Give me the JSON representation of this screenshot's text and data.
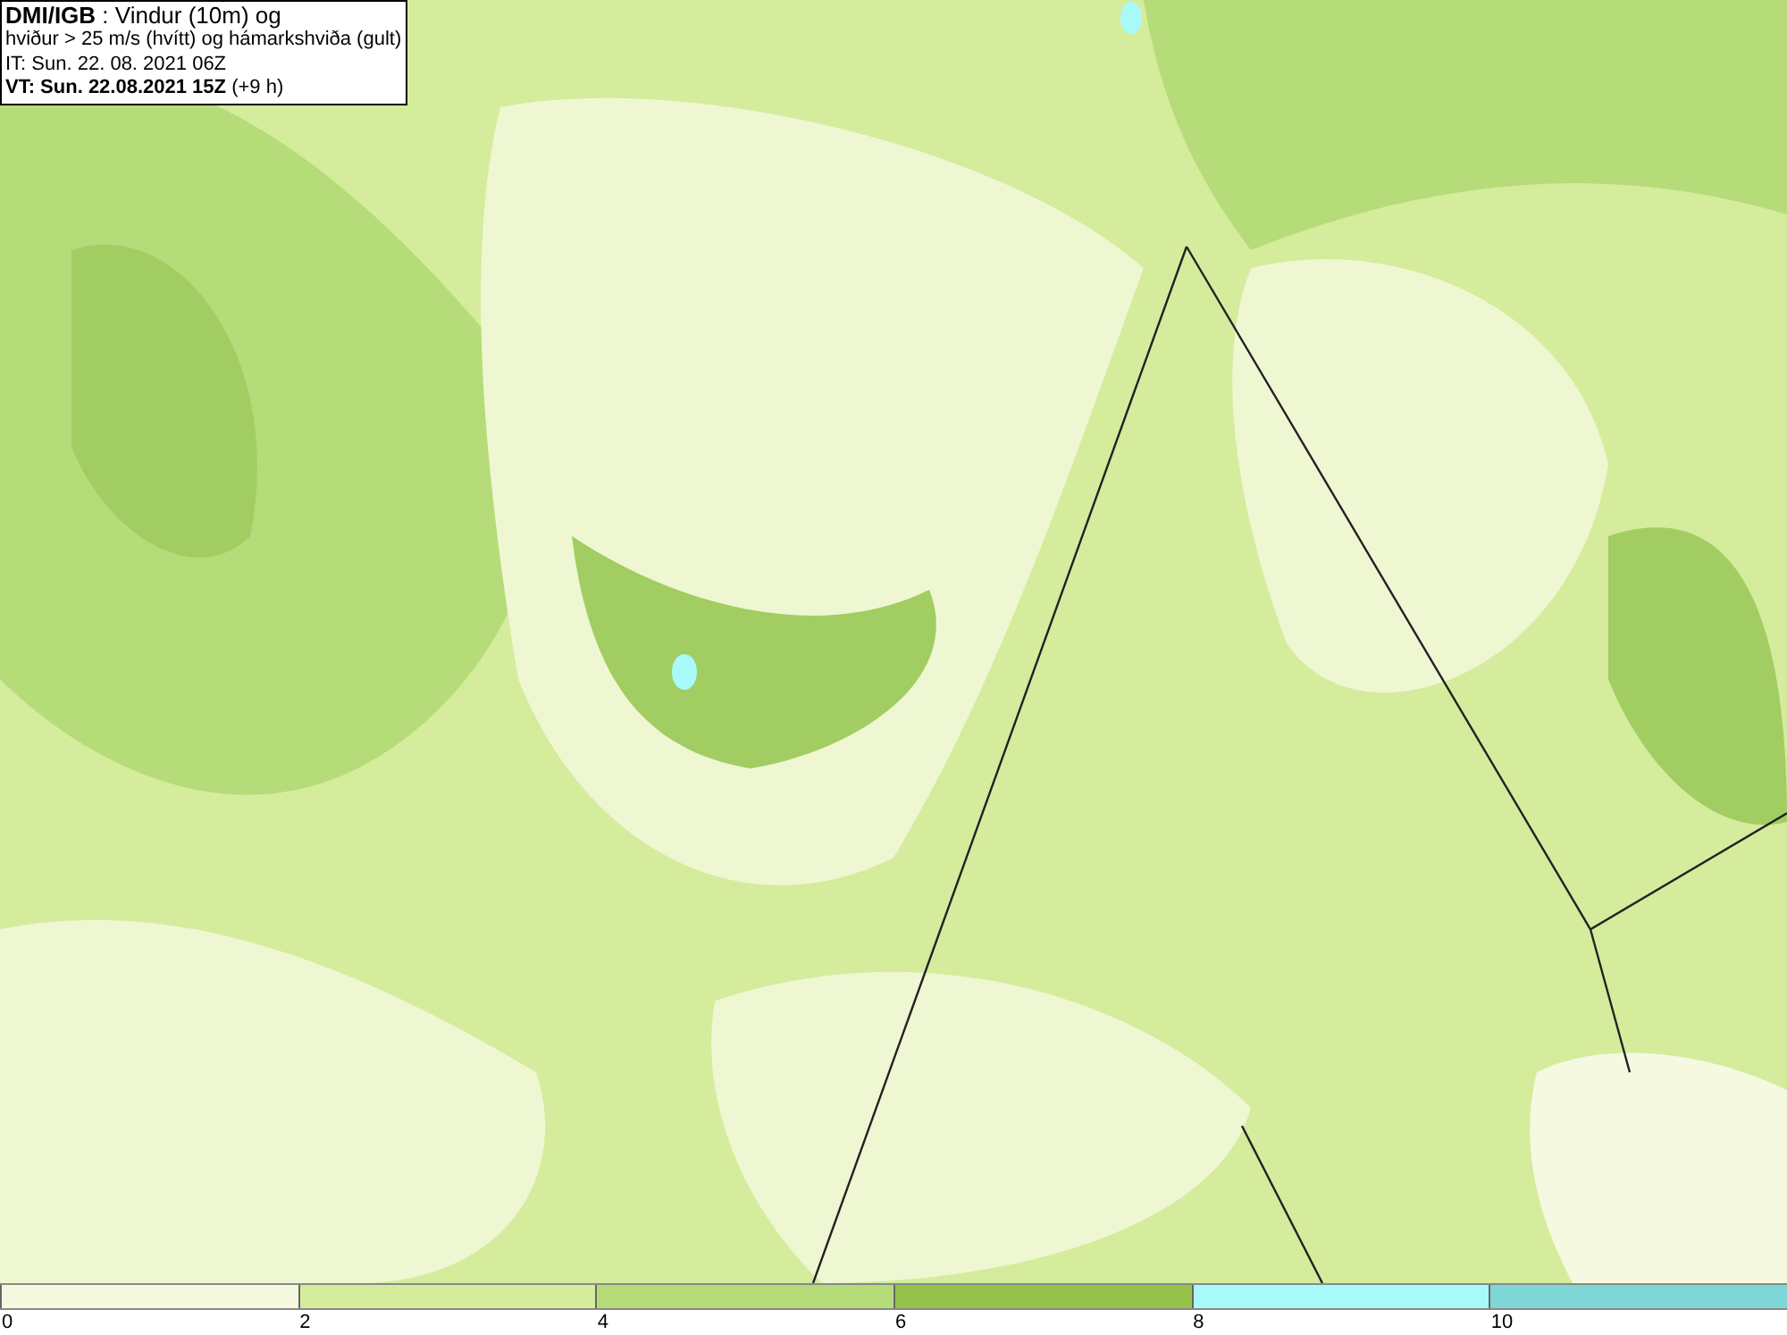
{
  "title_box": {
    "lines": [
      "**DMI/IGB** : Vindur (10m) og",
      "hviður > 25 m/s (hvítt) og hámarkshviða (gult)",
      "IT: Sun. 22. 08. 2021 06Z",
      "**VT: Sun. 22.08.2021 15Z** (+9 h)"
    ]
  },
  "legend": {
    "segments": [
      {
        "color": "#f4f9e0"
      },
      {
        "color": "#d4ec9c"
      },
      {
        "color": "#b5dc78"
      },
      {
        "color": "#97c24a"
      },
      {
        "color": "#a8fafa"
      },
      {
        "color": "#7fd6d6"
      }
    ],
    "ticks": [
      "0",
      "2",
      "4",
      "6",
      "8",
      "10"
    ]
  }
}
